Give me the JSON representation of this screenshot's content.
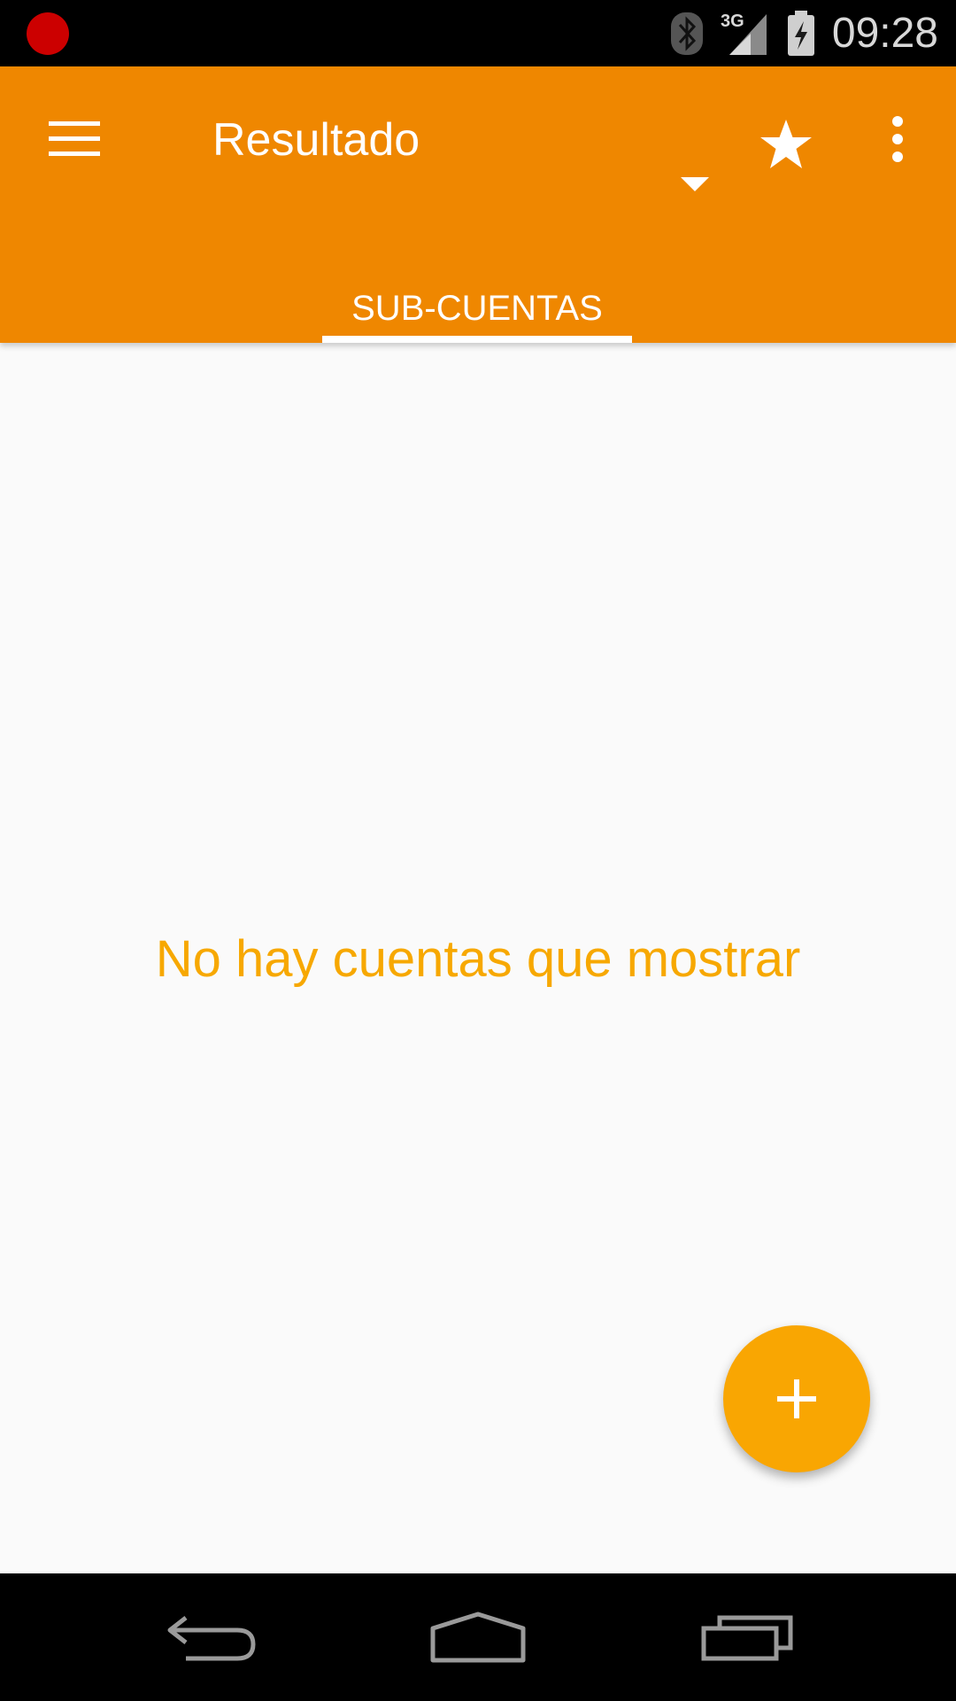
{
  "status_bar": {
    "time": "09:28",
    "network_label": "3G",
    "icons": [
      "record-icon",
      "bluetooth-icon",
      "signal-3g-icon",
      "battery-charging-icon"
    ]
  },
  "app_bar": {
    "title": "Resultado",
    "color": "#ef8700",
    "actions": [
      "menu-icon",
      "dropdown-arrow-icon",
      "star-icon",
      "overflow-menu-icon"
    ]
  },
  "tabs": [
    {
      "label": "SUB-CUENTAS",
      "selected": true
    }
  ],
  "content": {
    "empty_message": "No hay cuentas que mostrar",
    "accent_color": "#f7a800"
  },
  "fab": {
    "icon": "plus-icon",
    "color": "#f9a602"
  },
  "nav_bar": {
    "icons": [
      "back-icon",
      "home-icon",
      "recents-icon"
    ]
  }
}
